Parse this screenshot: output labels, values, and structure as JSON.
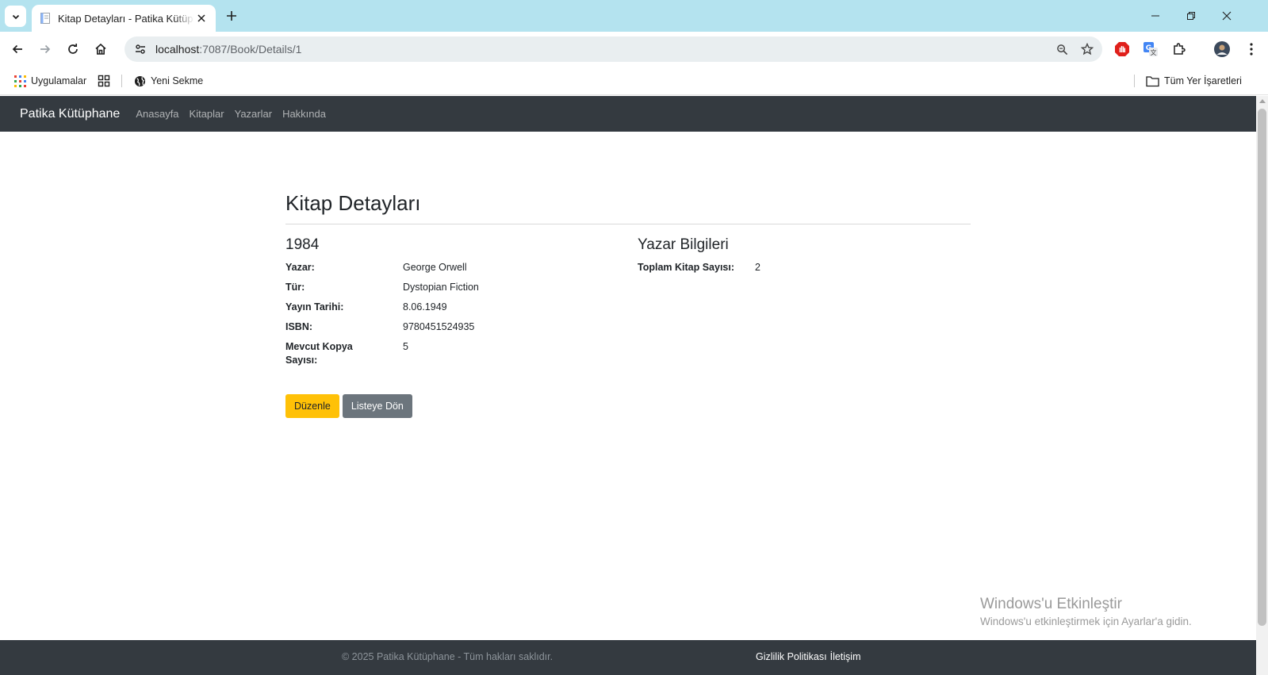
{
  "browser": {
    "tab_title": "Kitap Detayları - Patika Kütüphane",
    "url_host": "localhost",
    "url_rest": ":7087/Book/Details/1",
    "bookmarks": {
      "apps": "Uygulamalar",
      "new_tab": "Yeni Sekme",
      "all_bookmarks": "Tüm Yer İşaretleri"
    }
  },
  "navbar": {
    "brand": "Patika Kütüphane",
    "links": [
      "Anasayfa",
      "Kitaplar",
      "Yazarlar",
      "Hakkında"
    ]
  },
  "page": {
    "title": "Kitap Detayları",
    "book": {
      "title": "1984",
      "fields": [
        {
          "label": "Yazar:",
          "value": "George Orwell"
        },
        {
          "label": "Tür:",
          "value": "Dystopian Fiction"
        },
        {
          "label": "Yayın Tarihi:",
          "value": "8.06.1949"
        },
        {
          "label": "ISBN:",
          "value": "9780451524935"
        },
        {
          "label": "Mevcut Kopya Sayısı:",
          "value": "5"
        }
      ]
    },
    "author_info": {
      "title": "Yazar Bilgileri",
      "label": "Toplam Kitap Sayısı:",
      "value": "2"
    },
    "buttons": {
      "edit": "Düzenle",
      "back": "Listeye Dön"
    }
  },
  "footer": {
    "copyright": "© 2025 Patika Kütüphane - Tüm hakları saklıdır.",
    "privacy": "Gizlilik Politikası",
    "contact": "İletişim"
  },
  "watermark": {
    "title": "Windows'u Etkinleştir",
    "subtitle": "Windows'u etkinleştirmek için Ayarlar'a gidin."
  },
  "colors": {
    "navbar_bg": "#343a40",
    "warning": "#ffc107",
    "secondary": "#6c757d",
    "tabstrip": "#b4e3ef"
  }
}
